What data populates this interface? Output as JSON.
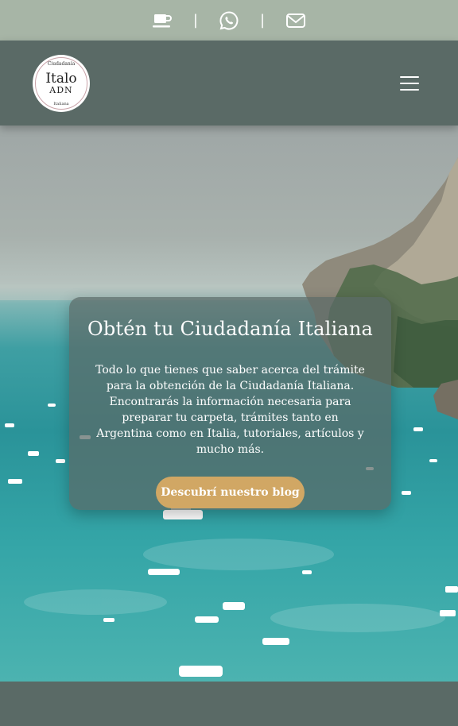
{
  "topbar": {
    "icons": [
      "coffee-cup-icon",
      "whatsapp-icon",
      "mail-icon"
    ],
    "separator": "|",
    "background": "#a7b5a6"
  },
  "header": {
    "logo": {
      "top_text": "Ciudadanía",
      "main_text": "Italo",
      "sub_text": "ADN",
      "bottom_text": "Italiana"
    },
    "menu_icon": "hamburger-menu-icon",
    "background": "#5a6a66"
  },
  "hero": {
    "title": "Obtén tu Ciudadanía Italiana",
    "description": "Todo lo que tienes que saber acerca del trámite para la obtención de la Ciudadanía Italiana. Encontrarás la información necesaria para preparar tu carpeta, trámites tanto en Argentina como en Italia, tutoriales, artículos y mucho más.",
    "cta_label": "Descubrí nuestro blog",
    "cta_color": "#d1a764"
  }
}
